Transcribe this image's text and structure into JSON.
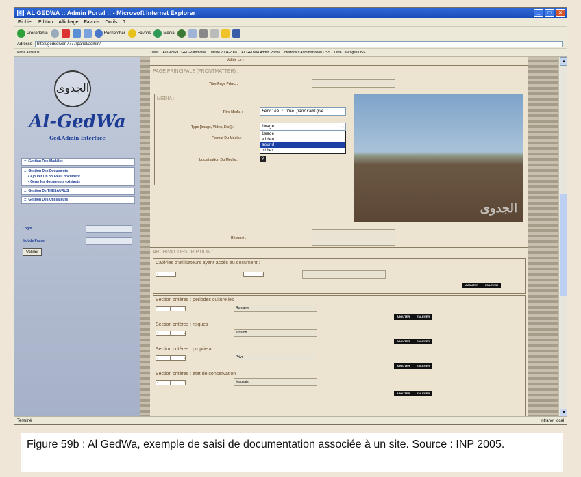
{
  "window": {
    "title": "AL GEDWA :: Admin Portal :: - Microsoft Internet Explorer"
  },
  "menubar": [
    "Fichier",
    "Edition",
    "Affichage",
    "Favoris",
    "Outils",
    "?"
  ],
  "toolbar": {
    "back": "Précédente",
    "search": "Rechercher",
    "favorites": "Favoris",
    "media": "Média"
  },
  "address": {
    "label": "Adresse",
    "url": "http://gedserver:7777/panel/admin/"
  },
  "links": {
    "label": "Notre Antivirus",
    "label2": "Liens",
    "items": [
      "Al-GedWa . GED-Patrimoine . Tunisie 2004-2006",
      "AL GEDWA Admin Portal",
      "Interface d'Administration OSS",
      "Liste Ouvrages OSS"
    ]
  },
  "sidebar": {
    "logo_arabic": "الجدوى",
    "logo_title": "Al-GedWa",
    "logo_sub": "Ged.Admin Interface",
    "menu": [
      {
        "label": "::: Gestion Des Modèles"
      },
      {
        "label": "::: Gestion Des Documents",
        "subs": [
          "• Ajouter Un nouveau document.",
          "• Gérer les documents existants"
        ]
      },
      {
        "label": "::: Gestion De THESAURUS"
      },
      {
        "label": "::: Gestion Des Utilisateurs"
      }
    ],
    "login_label": "Login",
    "password_label": "Mot de Passe",
    "submit": "Valider"
  },
  "main": {
    "top_label": "Valide Le :",
    "frontmatter_title": "PAGE PRINCIPALE (FRONTMATTER) :",
    "title_page_label": "Titre Page Princ. :",
    "media_title": "MEDIA :",
    "titre_media_label": "Titre Media :",
    "titre_media_value": "Fernine : Vue panoramique",
    "type_label": "Type [Image, Video, Etc.] :",
    "type_value": "image",
    "type_options": [
      "image",
      "video",
      "sound",
      "other"
    ],
    "type_selected_index": 2,
    "format_label": "Format Du Media :",
    "location_label": "Localisation Du Media :",
    "watermark": "الجدوى",
    "resume_label": "Résumé :",
    "archival_title": "ARCHIVAL DESCRIPTION :",
    "users_label": "Catéries d'utilisateurs ayant accès au document :",
    "users_value1": "1",
    "users_value2": "1",
    "add_label": "AJOUTER",
    "remove_label": "ENLEVER",
    "criteria": [
      {
        "title": "Section critères : periodes culturelles",
        "v1": "1",
        "v2": "1",
        "v3": "Romaine"
      },
      {
        "title": "Section critères : risques",
        "v1": "1",
        "v2": "1",
        "v3": "érosion"
      },
      {
        "title": "Section critères : proprieta",
        "v1": "1",
        "v2": "1",
        "v3": "Privé"
      },
      {
        "title": "Section critères : etat de conservation",
        "v1": "4",
        "v2": "1",
        "v3": "Mauvais"
      }
    ]
  },
  "status": {
    "left": "Terminé",
    "right": "Intranet local"
  },
  "caption": "Figure 59b : Al GedWa, exemple de saisi de documentation associée à un site. Source : INP 2005."
}
